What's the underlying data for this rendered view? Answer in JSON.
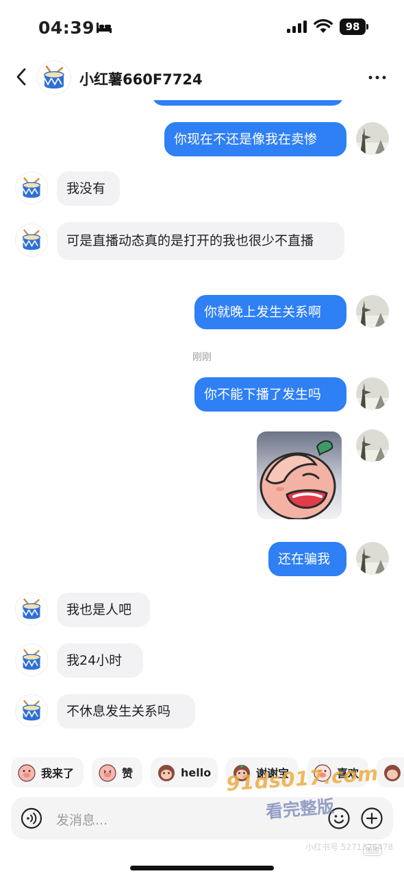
{
  "status_bar": {
    "time": "04:39",
    "battery": "98"
  },
  "header": {
    "title": "小红薯660F7724"
  },
  "messages": [
    {
      "side": "out",
      "text": "你现在不还是像我在卖惨"
    },
    {
      "side": "in",
      "text": "我没有"
    },
    {
      "side": "in",
      "text": "可是直播动态真的是打开的我也很少不直播"
    },
    {
      "side": "out",
      "text": "你就晚上发生关系啊"
    },
    {
      "type": "timestamp",
      "text": "刚刚"
    },
    {
      "side": "out",
      "text": "你不能下播了发生吗"
    },
    {
      "side": "out",
      "type": "sticker",
      "sticker": "facepalm-radish-sticker"
    },
    {
      "side": "out",
      "text": "还在骗我"
    },
    {
      "side": "in",
      "text": "我也是人吧"
    },
    {
      "side": "in",
      "text": "我24小时"
    },
    {
      "side": "in",
      "text": "不休息发生关系吗"
    }
  ],
  "quick_replies": [
    "我来了",
    "赞",
    "hello",
    "谢谢宝",
    "喜欢"
  ],
  "input": {
    "placeholder": "发消息..."
  },
  "watermark": {
    "url": "91ds017.com",
    "text": "看完整版",
    "faint": "小红书号 5271326478",
    "badge": "图图"
  },
  "colors": {
    "accent": "#2f7ff5",
    "incoming_bubble": "#f2f2f4",
    "chip_bg": "#f5f5f6"
  }
}
